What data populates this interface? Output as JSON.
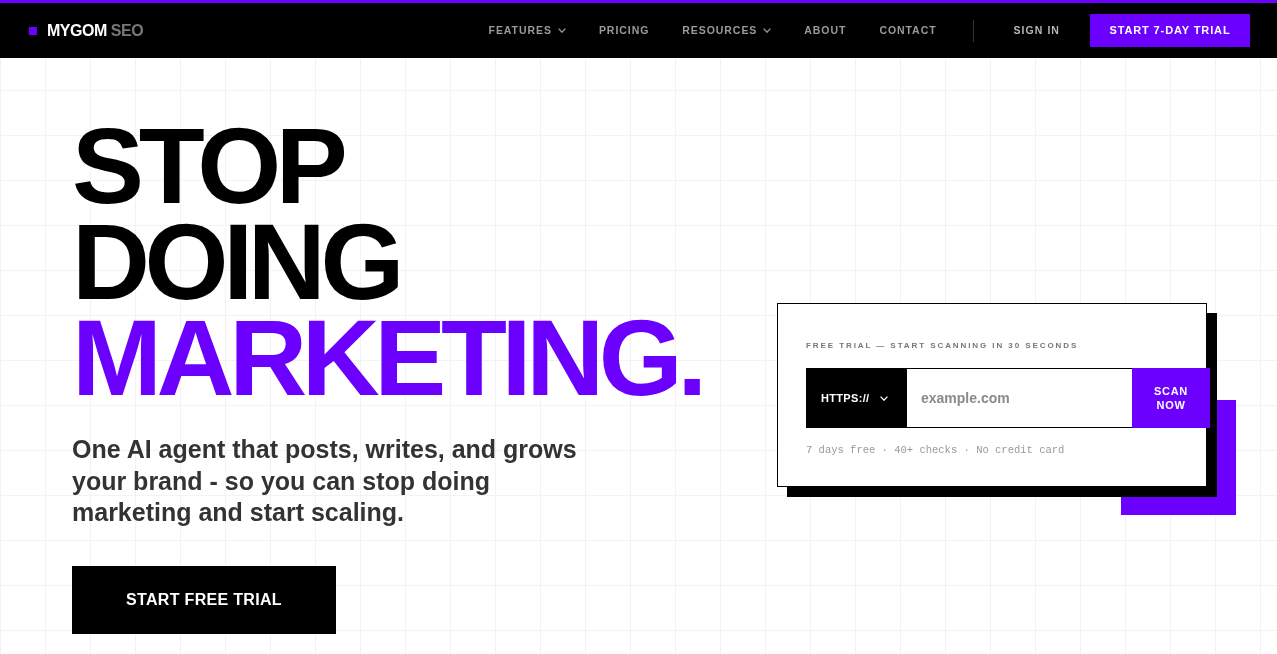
{
  "navbar": {
    "logo": {
      "text": "MYGOM",
      "suffix": "SEO"
    },
    "links": [
      {
        "label": "FEATURES",
        "dropdown": true
      },
      {
        "label": "PRICING",
        "dropdown": false
      },
      {
        "label": "RESOURCES",
        "dropdown": true
      },
      {
        "label": "ABOUT",
        "dropdown": false
      },
      {
        "label": "CONTACT",
        "dropdown": false
      }
    ],
    "sign_in": "SIGN IN",
    "cta": "START 7-DAY TRIAL"
  },
  "hero": {
    "title_lines": [
      {
        "text": "STOP",
        "accent": false
      },
      {
        "text": "DOING",
        "accent": false
      },
      {
        "text": "MARKETING.",
        "accent": true
      }
    ],
    "subtitle": "One AI agent that posts, writes, and grows your brand - so you can stop doing marketing and start scaling.",
    "cta": "START FREE TRIAL"
  },
  "scan_card": {
    "label": "FREE TRIAL — START SCANNING IN 30 SECONDS",
    "protocol": "HTTPS://",
    "url_field": {
      "placeholder": "example.com"
    },
    "button": "SCAN NOW",
    "note": "7 days free · 40+ checks · No credit card"
  }
}
